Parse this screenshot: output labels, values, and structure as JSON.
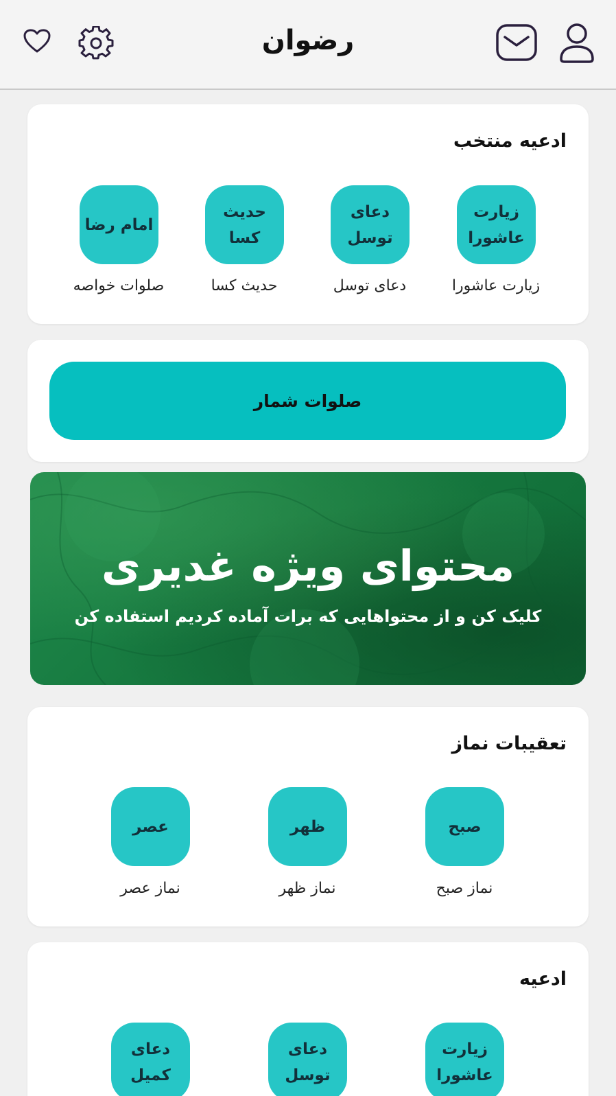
{
  "header": {
    "title": "رضوان",
    "icons": [
      "profile-icon",
      "mail-icon",
      "settings-icon",
      "heart-icon"
    ]
  },
  "featured_prayers": {
    "title": "ادعیه منتخب",
    "items": [
      {
        "tile": "زیارت عاشورا",
        "label": "زیارت عاشورا"
      },
      {
        "tile": "دعای توسل",
        "label": "دعای توسل"
      },
      {
        "tile": "حدیث کسا",
        "label": "حدیث کسا"
      },
      {
        "tile": "امام رضا",
        "label": "صلوات خواصه"
      }
    ]
  },
  "salawat_counter": {
    "label": "صلوات شمار"
  },
  "banner": {
    "title": "محتوای ویژه غدیری",
    "subtitle": "کلیک کن و از محتواهایی که برات آماده کردیم استفاده کن"
  },
  "prayer_supplications": {
    "title": "تعقیبات نماز",
    "items": [
      {
        "tile": "صبح",
        "label": "نماز صبح"
      },
      {
        "tile": "ظهر",
        "label": "نماز ظهر"
      },
      {
        "tile": "عصر",
        "label": "نماز عصر"
      }
    ]
  },
  "prayers": {
    "title": "ادعیه",
    "items": [
      {
        "tile": "زیارت عاشورا"
      },
      {
        "tile": "دعای توسل"
      },
      {
        "tile": "دعای کمیل"
      }
    ]
  },
  "colors": {
    "accent": "#06bfbf",
    "tile": "#26c6c6",
    "icon": "#2a1f3d",
    "banner": "#177a40"
  }
}
